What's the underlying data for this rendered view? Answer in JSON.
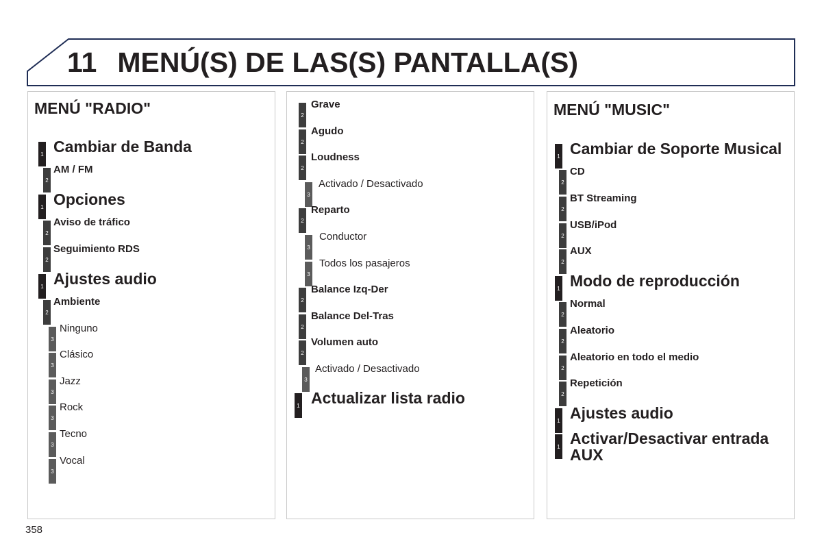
{
  "header": {
    "chapter_number": "11",
    "chapter_title": "MENÚ(S) DE LAS(S) PANTALLA(S)",
    "border_color": "#1f2d55"
  },
  "badge_colors": {
    "level1": "#231f20",
    "level2": "#3d3d3d",
    "level3": "#5b5b5b"
  },
  "panels": [
    {
      "title": "MENÚ \"RADIO\"",
      "items": [
        {
          "level": 1,
          "label": "Cambiar de Banda"
        },
        {
          "level": 2,
          "label": "AM / FM"
        },
        {
          "level": 1,
          "label": "Opciones"
        },
        {
          "level": 2,
          "label": "Aviso de tráfico"
        },
        {
          "level": 2,
          "label": "Seguimiento RDS"
        },
        {
          "level": 1,
          "label": "Ajustes audio"
        },
        {
          "level": 2,
          "label": "Ambiente"
        },
        {
          "level": 3,
          "label": "Ninguno"
        },
        {
          "level": 3,
          "label": "Clásico"
        },
        {
          "level": 3,
          "label": "Jazz"
        },
        {
          "level": 3,
          "label": "Rock"
        },
        {
          "level": 3,
          "label": "Tecno"
        },
        {
          "level": 3,
          "label": "Vocal"
        }
      ]
    },
    {
      "title": "",
      "items": [
        {
          "level": 2,
          "label": "Grave"
        },
        {
          "level": 2,
          "label": "Agudo"
        },
        {
          "level": 2,
          "label": "Loudness"
        },
        {
          "level": 3,
          "label": "Activado / Desactivado"
        },
        {
          "level": 2,
          "label": "Reparto"
        },
        {
          "level": 3,
          "label": "Conductor"
        },
        {
          "level": 3,
          "label": "Todos los pasajeros"
        },
        {
          "level": 2,
          "label": "Balance Izq-Der"
        },
        {
          "level": 2,
          "label": "Balance Del-Tras"
        },
        {
          "level": 2,
          "label": "Volumen auto"
        },
        {
          "level": 3,
          "label": "Activado / Desactivado"
        },
        {
          "level": 1,
          "label": "Actualizar lista radio"
        }
      ]
    },
    {
      "title": "MENÚ \"MUSIC\"",
      "items": [
        {
          "level": 1,
          "label": "Cambiar de Soporte Musical"
        },
        {
          "level": 2,
          "label": "CD"
        },
        {
          "level": 2,
          "label": "BT Streaming"
        },
        {
          "level": 2,
          "label": "USB/iPod"
        },
        {
          "level": 2,
          "label": "AUX"
        },
        {
          "level": 1,
          "label": "Modo de reproducción"
        },
        {
          "level": 2,
          "label": "Normal"
        },
        {
          "level": 2,
          "label": "Aleatorio"
        },
        {
          "level": 2,
          "label": "Aleatorio en todo el medio"
        },
        {
          "level": 2,
          "label": "Repetición"
        },
        {
          "level": 1,
          "label": "Ajustes audio"
        },
        {
          "level": 1,
          "label": "Activar/Desactivar entrada AUX",
          "lines": [
            "Activar/Desactivar entrada",
            "AUX"
          ]
        }
      ]
    }
  ],
  "footer": {
    "page_number": "358"
  }
}
